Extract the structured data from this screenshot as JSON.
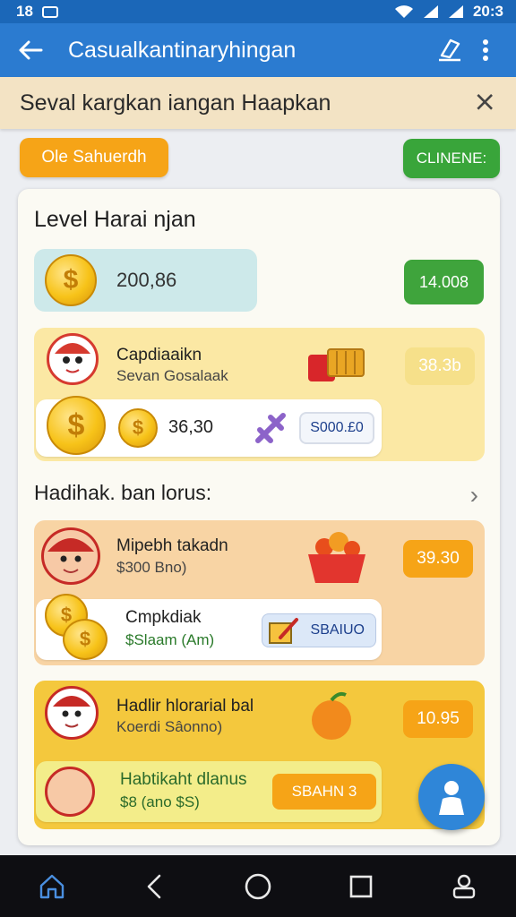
{
  "status_bar": {
    "left_text": "18",
    "time": "20:3"
  },
  "app_bar": {
    "title": "Casualkantinaryhingan"
  },
  "subheader": {
    "title": "Seval kargkan iangan Haapkan",
    "close_symbol": "⨉"
  },
  "pills": {
    "left": "Ole Sahuerdh",
    "right": "CLINENE:"
  },
  "section1": {
    "title": "Level Harai njan",
    "balance": "200,86",
    "balance_button": "14.008"
  },
  "row1": {
    "name": "Capdiaaikn",
    "subtitle": "Sevan Gosalaak",
    "price": "38.3b",
    "inner_value": "36,30",
    "inner_chip": "S000.£0"
  },
  "section2": {
    "title": "Hadihak. ban lorus:"
  },
  "row2": {
    "name": "Mipebh takadn",
    "subtitle": "$300 Bno)",
    "price": "39.30",
    "inner_name": "Cmpkdiak",
    "inner_subtitle": "$Slaam (Am)",
    "inner_chip": "SBAIUO"
  },
  "row3": {
    "name": "Hadlir hlorarial bal",
    "subtitle": "Koerdi Sâonno)",
    "price": "10.95",
    "inner_name": "Habtikaht dlanus",
    "inner_subtitle": "$8 (ano $S)",
    "inner_chip": "SBAHN 3"
  },
  "colors": {
    "status_bar": "#1b67b8",
    "app_bar": "#2b7bd0",
    "accent_green": "#3fa43c",
    "accent_orange": "#f6a417"
  }
}
